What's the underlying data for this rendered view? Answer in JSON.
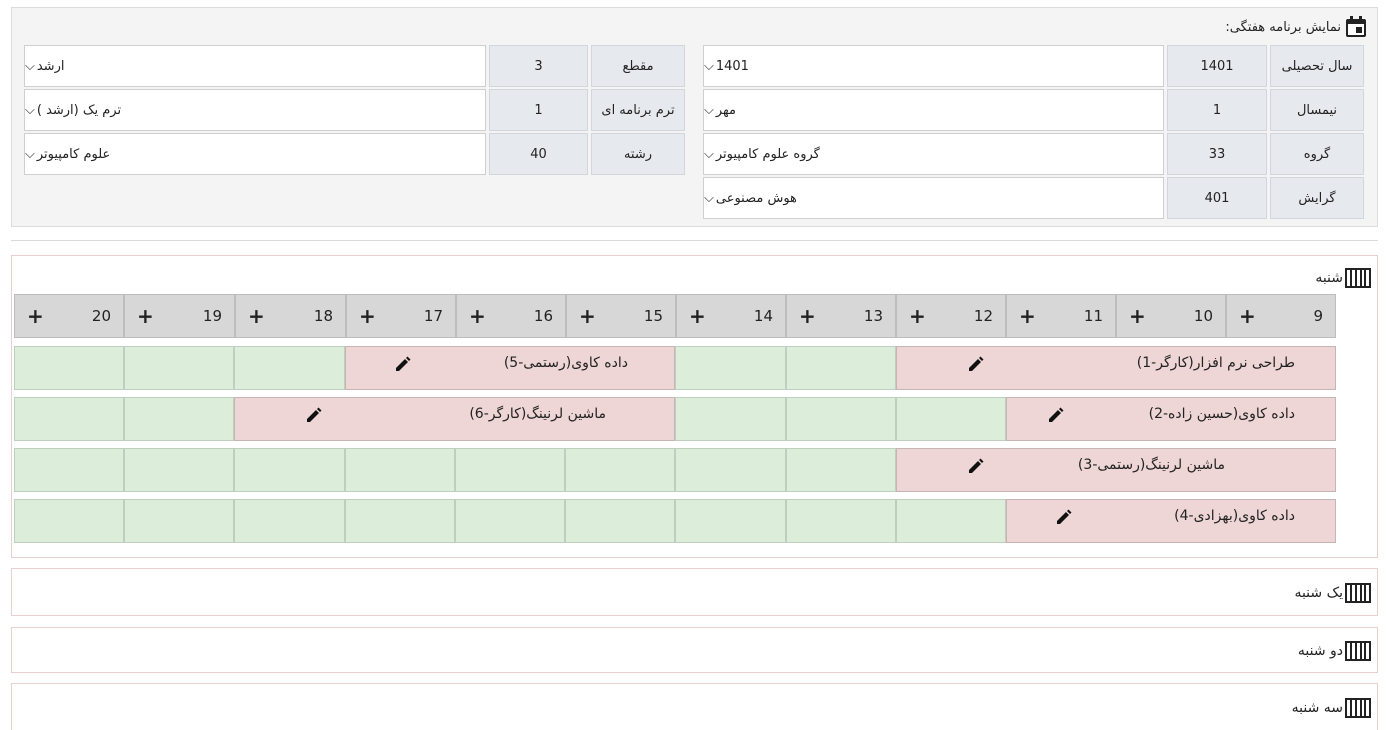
{
  "panel": {
    "title": "نمایش برنامه هفتگی:",
    "icon": "calendar-icon"
  },
  "filters": {
    "year": {
      "label": "سال تحصیلی",
      "code": "1401",
      "value": "1401"
    },
    "semester": {
      "label": "نیمسال",
      "code": "1",
      "value": "مهر"
    },
    "group": {
      "label": "گروه",
      "code": "33",
      "value": "گروه علوم کامپیوتر"
    },
    "orientation": {
      "label": "گرایش",
      "code": "401",
      "value": "هوش مصنوعی"
    },
    "level": {
      "label": "مقطع",
      "code": "3",
      "value": "ارشد"
    },
    "term": {
      "label": "ترم برنامه ای",
      "code": "1",
      "value": "ترم یک (ارشد )"
    },
    "field": {
      "label": "رشته",
      "code": "40",
      "value": "علوم کامپیوتر"
    }
  },
  "days": {
    "saturday": "شنبه",
    "sunday": "یک شنبه",
    "monday": "دو شنبه",
    "tuesday": "سه شنبه"
  },
  "hours": [
    "9",
    "10",
    "11",
    "12",
    "13",
    "14",
    "15",
    "16",
    "17",
    "18",
    "19",
    "20"
  ],
  "classes": {
    "c1": "طراحی نرم افزار(کارگر-1)",
    "c2": "داده کاوی(حسین زاده-2)",
    "c3": "ماشین لرنینگ(رستمی-3)",
    "c4": "داده کاوی(بهزادی-4)",
    "c5": "داده کاوی(رستمی-5)",
    "c6": "ماشین لرنینگ(کارگر-6)"
  },
  "colors": {
    "free_slot": "#dcedd9",
    "busy_slot": "#efd6d6",
    "hour_header": "#d7d7d7"
  }
}
